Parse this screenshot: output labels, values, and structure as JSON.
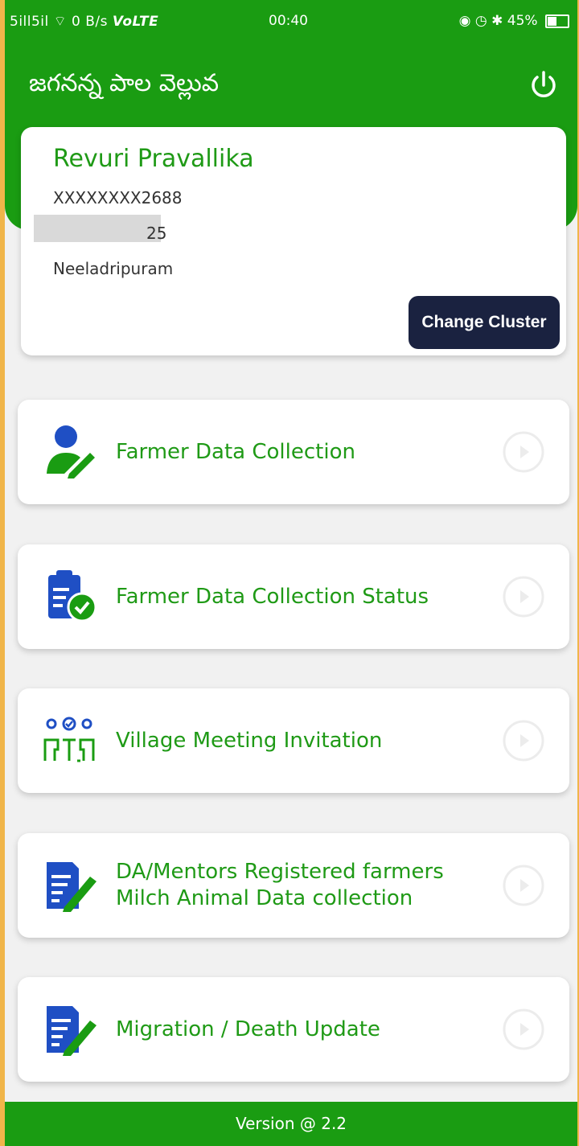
{
  "status_bar": {
    "network": "5ill5il",
    "speed": "0 B/s",
    "volte": "VoLTE",
    "time": "00:40",
    "battery": "45%"
  },
  "header": {
    "title": "జగనన్న పాల వెల్లువ"
  },
  "profile": {
    "name": "Revuri Pravallika",
    "id_masked": "XXXXXXXX2688",
    "partial_field": "25",
    "location": "Neeladripuram",
    "change_cluster_label": "Change Cluster"
  },
  "menu": [
    {
      "label": "Farmer Data Collection",
      "icon": "user-edit-icon"
    },
    {
      "label": "Farmer Data Collection Status",
      "icon": "clipboard-check-icon"
    },
    {
      "label": "Village Meeting Invitation",
      "icon": "meeting-icon"
    },
    {
      "label": "DA/Mentors Registered farmers Milch Animal Data collection",
      "icon": "document-edit-icon"
    },
    {
      "label": "Migration / Death Update",
      "icon": "document-edit-icon"
    }
  ],
  "footer": {
    "version": "Version @ 2.2"
  },
  "colors": {
    "primary_green": "#1a9c12",
    "button_navy": "#1a2240",
    "icon_blue": "#1f4fc4"
  }
}
